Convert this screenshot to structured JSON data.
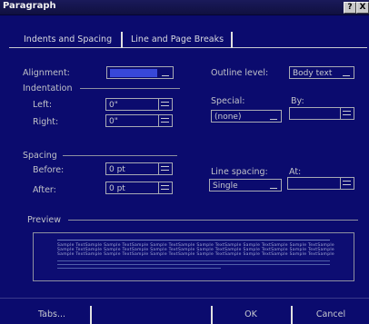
{
  "window": {
    "title": "Paragraph",
    "help_btn": "?",
    "close_btn": "X"
  },
  "tabs": [
    {
      "label": "Indents and Spacing",
      "active": true
    },
    {
      "label": "Line and Page Breaks",
      "active": false
    }
  ],
  "general": {
    "alignment_label": "Alignment:",
    "alignment_value": "",
    "outline_label": "Outline level:",
    "outline_value": "Body text"
  },
  "indentation": {
    "section_label": "Indentation",
    "left_label": "Left:",
    "left_value": "0\"",
    "right_label": "Right:",
    "right_value": "0\"",
    "special_label": "Special:",
    "special_value": "(none)",
    "by_label": "By:",
    "by_value": ""
  },
  "spacing": {
    "section_label": "Spacing",
    "before_label": "Before:",
    "before_value": "0 pt",
    "after_label": "After:",
    "after_value": "0 pt",
    "line_spacing_label": "Line spacing:",
    "line_spacing_value": "Single",
    "at_label": "At:",
    "at_value": ""
  },
  "preview": {
    "section_label": "Preview",
    "sample_word": "Sample TextSample"
  },
  "buttons": {
    "tabs": "Tabs...",
    "ok": "OK",
    "cancel": "Cancel"
  }
}
